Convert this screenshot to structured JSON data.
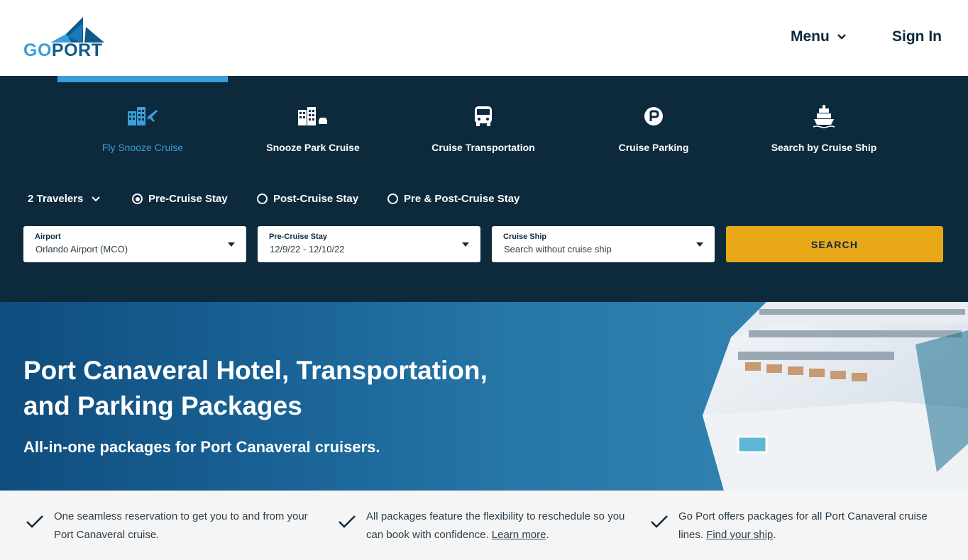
{
  "header": {
    "logo_go": "GO",
    "logo_port": "PORT",
    "menu_label": "Menu",
    "signin_label": "Sign In"
  },
  "tabs": [
    {
      "label": "Fly Snooze Cruise",
      "icon": "fly-snooze-icon",
      "active": true
    },
    {
      "label": "Snooze Park Cruise",
      "icon": "snooze-park-icon",
      "active": false
    },
    {
      "label": "Cruise Transportation",
      "icon": "bus-icon",
      "active": false
    },
    {
      "label": "Cruise Parking",
      "icon": "parking-icon",
      "active": false
    },
    {
      "label": "Search by Cruise Ship",
      "icon": "cruise-ship-icon",
      "active": false
    }
  ],
  "options": {
    "travelers": "2 Travelers",
    "stay_options": [
      {
        "label": "Pre-Cruise Stay",
        "selected": true
      },
      {
        "label": "Post-Cruise Stay",
        "selected": false
      },
      {
        "label": "Pre & Post-Cruise Stay",
        "selected": false
      }
    ]
  },
  "fields": {
    "airport": {
      "label": "Airport",
      "value": "Orlando Airport (MCO)"
    },
    "dates": {
      "label": "Pre-Cruise Stay",
      "value": "12/9/22 - 12/10/22"
    },
    "ship": {
      "label": "Cruise Ship",
      "value": "Search without cruise ship"
    }
  },
  "search_label": "SEARCH",
  "hero": {
    "title_line1": "Port Canaveral Hotel, Transportation,",
    "title_line2": "and Parking Packages",
    "subtitle": "All-in-one packages for Port Canaveral cruisers."
  },
  "features": [
    {
      "text": "One seamless reservation to get you to and from your Port Canaveral cruise.",
      "link": "",
      "after": ""
    },
    {
      "text": "All packages feature the flexibility to reschedule so you can book with confidence. ",
      "link": "Learn more",
      "after": "."
    },
    {
      "text": "Go Port offers packages for all Port Canaveral cruise lines. ",
      "link": "Find your ship",
      "after": "."
    }
  ],
  "colors": {
    "navy": "#0d2a3d",
    "accent_blue": "#3a9fd9",
    "search_yellow": "#e9a817"
  }
}
